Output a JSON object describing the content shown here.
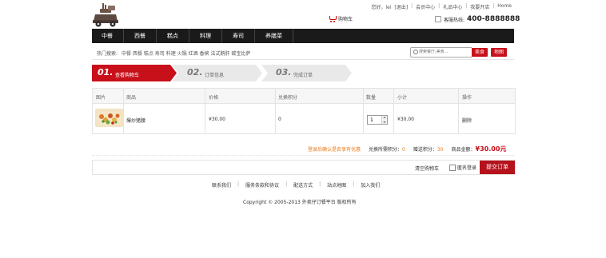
{
  "header": {
    "greeting": "您好，lei",
    "logout": "[退出]",
    "member_center": "会员中心",
    "gift_center": "礼品中心",
    "open_shop": "我要开店",
    "home": "Home",
    "cart": "购物车",
    "hotline_label": "客服热线:",
    "hotline_number": "400-8888888"
  },
  "nav": {
    "items": [
      "中餐",
      "西餐",
      "糕点",
      "料理",
      "寿司",
      "养膳菜"
    ]
  },
  "search": {
    "hot_label": "热门搜索:",
    "hot_words": [
      "中餐",
      "西餐",
      "糕点",
      "寿司",
      "料理",
      "火锅",
      "红酒",
      "香槟",
      "法式鹅肝",
      "碳宝比萨"
    ],
    "placeholder": "搜索餐厅,美食...",
    "food_button": "美食",
    "map_button": "地图"
  },
  "steps": [
    {
      "num": "01.",
      "label": "查看购物车",
      "active": true
    },
    {
      "num": "02.",
      "label": "订单信息",
      "active": false
    },
    {
      "num": "03.",
      "label": "完成订单",
      "active": false
    }
  ],
  "table": {
    "headers": [
      "图片",
      "商品",
      "价格",
      "兑换积分",
      "数量",
      "小计",
      "操作"
    ],
    "row": {
      "product": "爆炒猪腰",
      "price": "¥30.00",
      "points": "0",
      "quantity": "1",
      "subtotal": "¥30.00",
      "action": "删除"
    }
  },
  "summary": {
    "login_hint": "登录后确认是否享有优惠",
    "points_needed_label": "兑换所需积分：",
    "points_needed": "0",
    "gift_points_label": "赠送积分：",
    "gift_points": "30",
    "total_label": "商品金额：",
    "total": "¥30.00元"
  },
  "actions": {
    "clear_cart": "清空购物车",
    "anonymous": "匿名登录",
    "submit": "提交订单"
  },
  "footer": {
    "links": [
      "联系我们",
      "服务条款和协议",
      "配送方式",
      "站点地图",
      "加入我们"
    ],
    "copyright": "Copyright © 2005-2013 外卖仔订餐平台 版权所有"
  },
  "colors": {
    "accent": "#c8101a",
    "nav_bg": "#1a1a1a",
    "highlight": "#e87a17"
  }
}
